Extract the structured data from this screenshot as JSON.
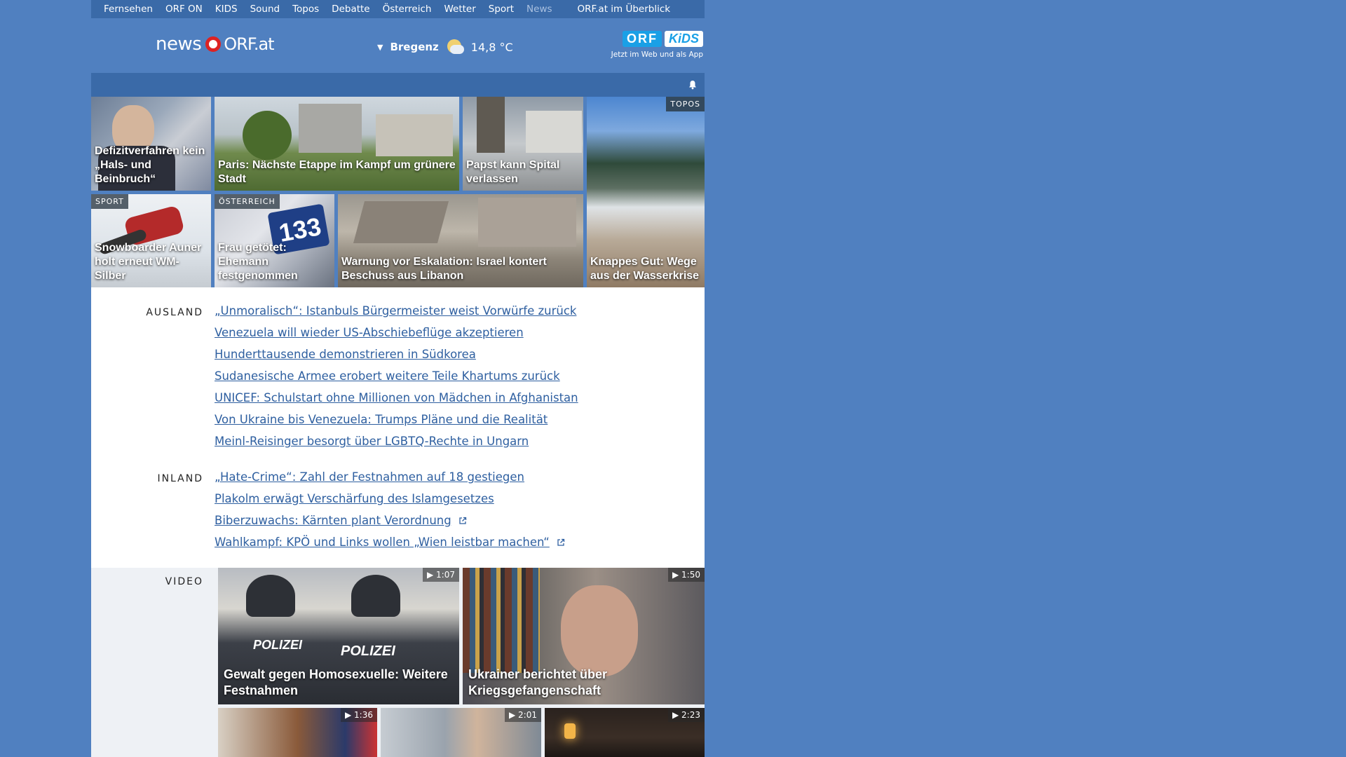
{
  "topnav": {
    "items": [
      "Fernsehen",
      "ORF ON",
      "KIDS",
      "Sound",
      "Topos",
      "Debatte",
      "Österreich",
      "Wetter",
      "Sport",
      "News"
    ],
    "overview": "ORF.at im Überblick"
  },
  "header": {
    "logo_news": "news",
    "logo_orf": "ORF.at",
    "weather_city": "Bregenz",
    "weather_temp": "14,8 °C",
    "kids_orf": "ORF",
    "kids_kids": "KiDS",
    "kids_tagline": "Jetzt im Web und als App"
  },
  "tiles": [
    {
      "title": "Defizitverfahren kein „Hals- und Beinbruch“",
      "category": ""
    },
    {
      "title": "Paris: Nächste Etappe im Kampf um grünere Stadt",
      "category": ""
    },
    {
      "title": "Papst kann Spital verlassen",
      "category": ""
    },
    {
      "title": "Knappes Gut: Wege aus der Wasserkrise",
      "category": "TOPOS"
    },
    {
      "title": "Snowboarder Auner holt erneut WM-Silber",
      "category": "SPORT"
    },
    {
      "title": "Frau getötet: Ehemann festgenommen",
      "category": "ÖSTERREICH"
    },
    {
      "title": "Warnung vor Eskalation: Israel kontert Beschuss aus Libanon",
      "category": ""
    }
  ],
  "ausland": {
    "label": "AUSLAND",
    "links": [
      "„Unmoralisch“: Istanbuls Bürgermeister weist Vorwürfe zurück",
      "Venezuela will wieder US-Abschiebeflüge akzeptieren",
      "Hunderttausende demonstrieren in Südkorea",
      "Sudanesische Armee erobert weitere Teile Khartums zurück",
      "UNICEF: Schulstart ohne Millionen von Mädchen in Afghanistan",
      "Von Ukraine bis Venezuela: Trumps Pläne und die Realität",
      "Meinl-Reisinger besorgt über LGBTQ-Rechte in Ungarn"
    ]
  },
  "inland": {
    "label": "INLAND",
    "links": [
      "„Hate-Crime“: Zahl der Festnahmen auf 18 gestiegen",
      "Plakolm erwägt Verschärfung des Islamgesetzes",
      "Biberzuwachs: Kärnten plant Verordnung",
      "Wahlkampf: KPÖ und Links wollen „Wien leistbar machen“"
    ]
  },
  "video": {
    "label": "VIDEO",
    "items": [
      {
        "title": "Gewalt gegen Homosexuelle: Weitere Festnahmen",
        "duration": "1:07",
        "police": "POLIZEI"
      },
      {
        "title": "Ukrainer berichtet über Kriegsgefangenschaft",
        "duration": "1:50"
      },
      {
        "title": "",
        "duration": "1:36"
      },
      {
        "title": "",
        "duration": "2:01"
      },
      {
        "title": "",
        "duration": "2:23"
      }
    ]
  },
  "colors": {
    "background": "#5080c0",
    "nav_bar": "#3a6aa8",
    "link": "#2e5fa0",
    "brand_red": "#dd2222"
  }
}
